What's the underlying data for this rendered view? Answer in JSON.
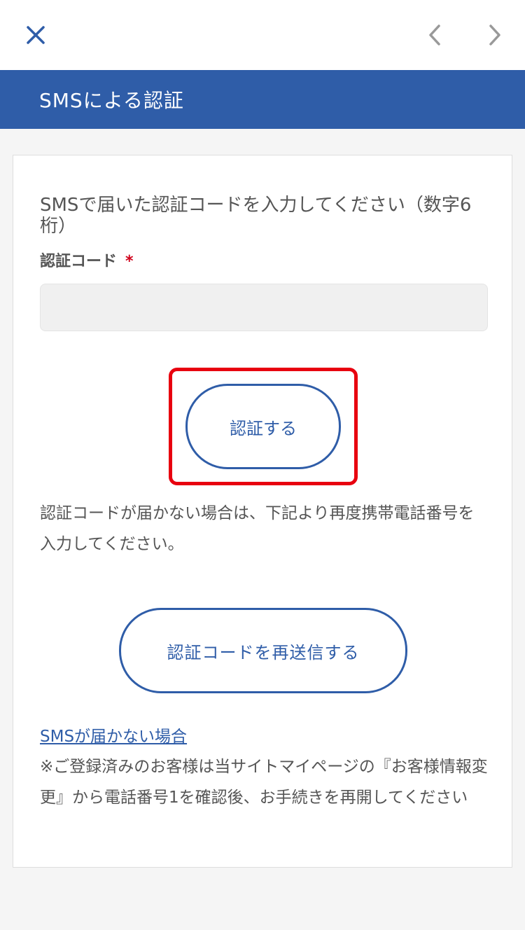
{
  "nav": {
    "close_icon": "close-icon",
    "prev_icon": "chevron-left-icon",
    "next_icon": "chevron-right-icon"
  },
  "header": {
    "title": "SMSによる認証"
  },
  "form": {
    "instruction": "SMSで届いた認証コードを入力してください（数字6桁）",
    "code_label": "認証コード",
    "required_mark": "*",
    "code_value": "",
    "verify_button": "認証する"
  },
  "note": {
    "resend_instruction": "認証コードが届かない場合は、下記より再度携帯電話番号を入力してください。",
    "resend_button": "認証コードを再送信する",
    "sms_link": "SMSが届かない場合",
    "sms_note": "※ご登録済みのお客様は当サイトマイページの『お客様情報変更』から電話番号1を確認後、お手続きを再開してください"
  },
  "colors": {
    "brand": "#2f5da8",
    "highlight": "#e8000f",
    "required": "#d0021b"
  }
}
